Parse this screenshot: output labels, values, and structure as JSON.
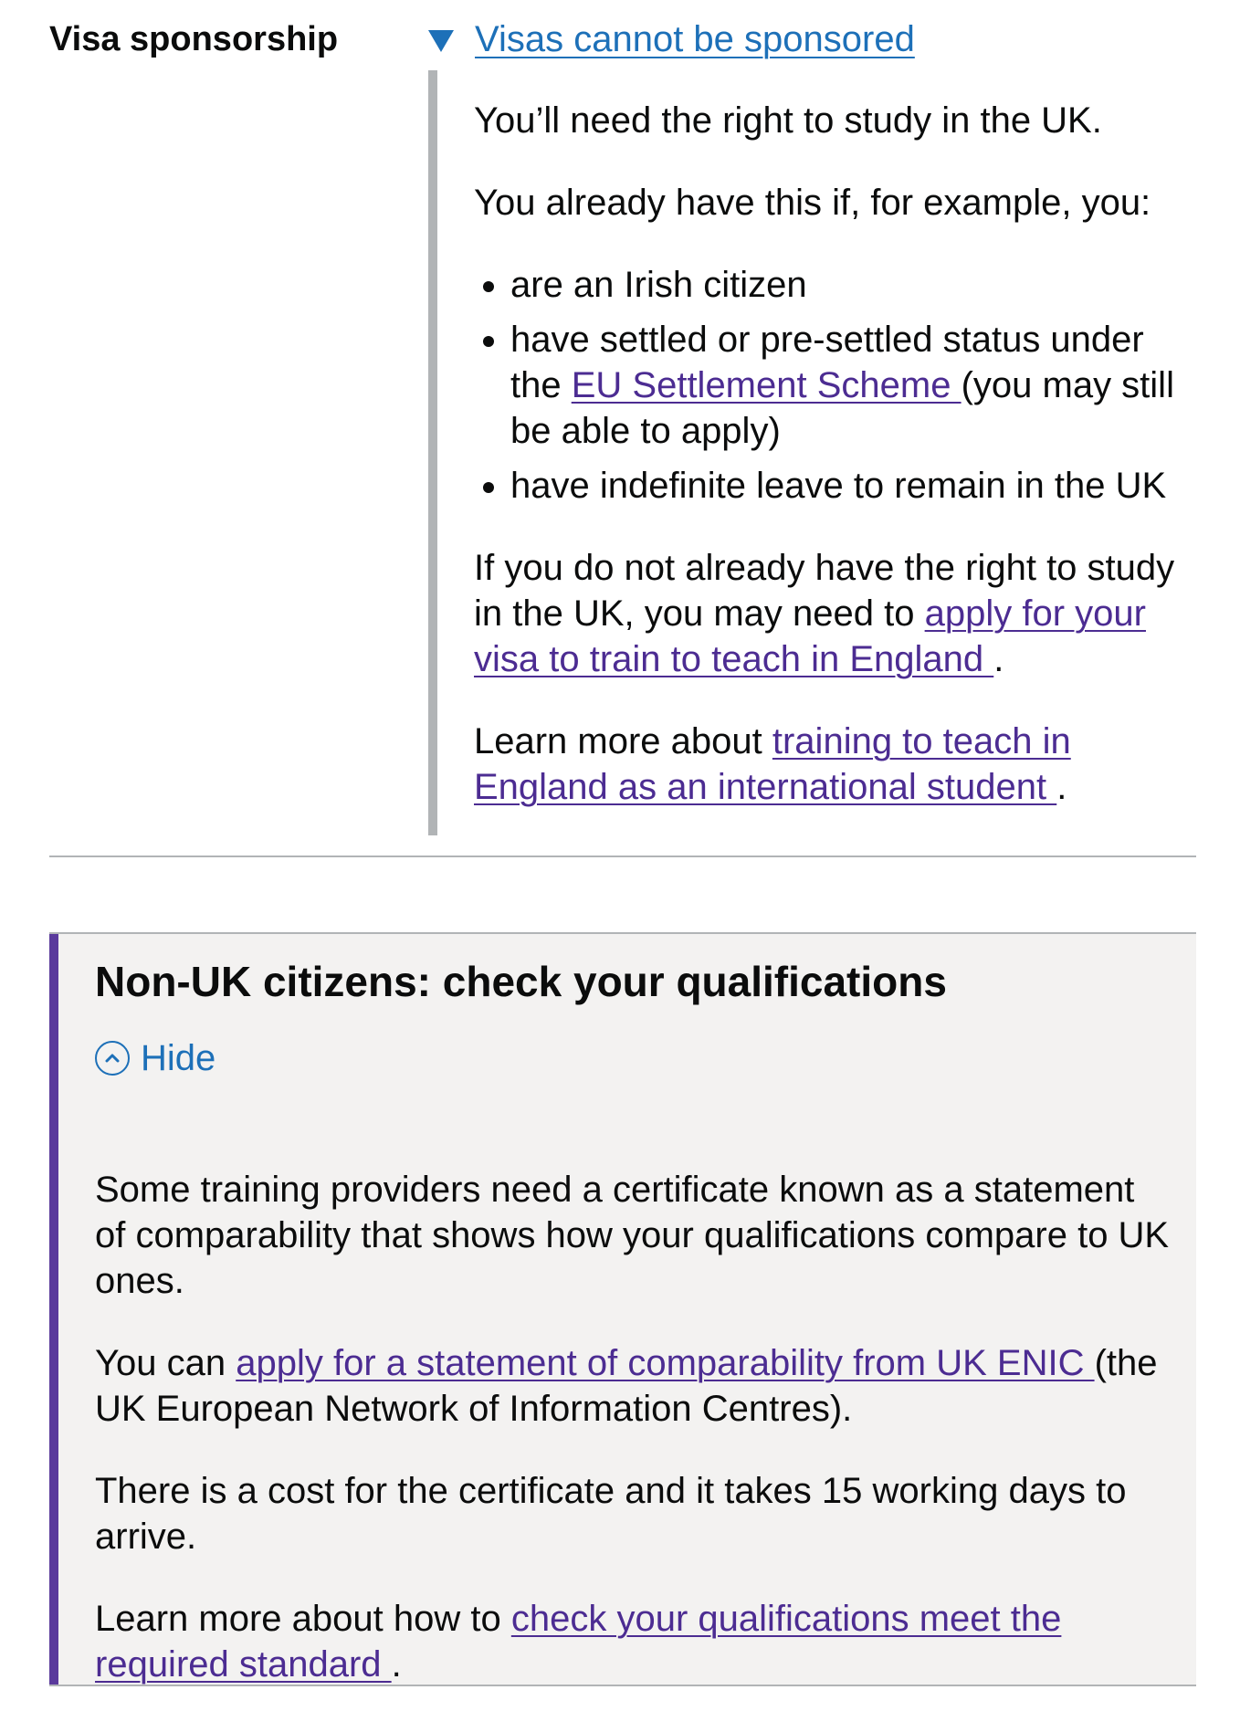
{
  "visa": {
    "key": "Visa sponsorship",
    "summary": "Visas cannot be sponsored",
    "intro": "You’ll need the right to study in the UK.",
    "already": "You already have this if, for example, you:",
    "bullet_1": "are an Irish citizen",
    "bullet_2_before": "have settled or pre-settled status under the ",
    "bullet_2_link": "EU Settlement Scheme ",
    "bullet_2_after": "(you may still be able to apply)",
    "bullet_3": "have indefinite leave to remain in the UK",
    "para_visa_before": "If you do not already have the right to study in the UK, you may need to ",
    "para_visa_link": "apply for your visa to train to teach in England ",
    "para_visa_after": ".",
    "para_learn_before": "Learn more about ",
    "para_learn_link": "training to teach in England as an international student ",
    "para_learn_after": "."
  },
  "inset": {
    "title": "Non-UK citizens: check your qualifications",
    "hide_label": "Hide",
    "para_1": "Some training providers need a certificate known as a statement of comparability that shows how your qualifications compare to UK ones.",
    "para_2_before": "You can ",
    "para_2_link": "apply for a statement of comparability from UK ENIC ",
    "para_2_after": "(the UK European Network of Information Centres).",
    "para_3": "There is a cost for the certificate and it takes 15 working days to arrive.",
    "para_4_before": "Learn more about how to ",
    "para_4_link": "check your qualifications meet the required standard ",
    "para_4_after": "."
  },
  "colors": {
    "link": "#4c2c92",
    "summary_link": "#1d70b8",
    "inset_bar": "#5a3a9c",
    "inset_background": "#f3f2f1",
    "details_border": "#b1b4b6"
  },
  "icons": {
    "summary": "triangle-down-icon",
    "hide": "chevron-up-circle-icon"
  }
}
